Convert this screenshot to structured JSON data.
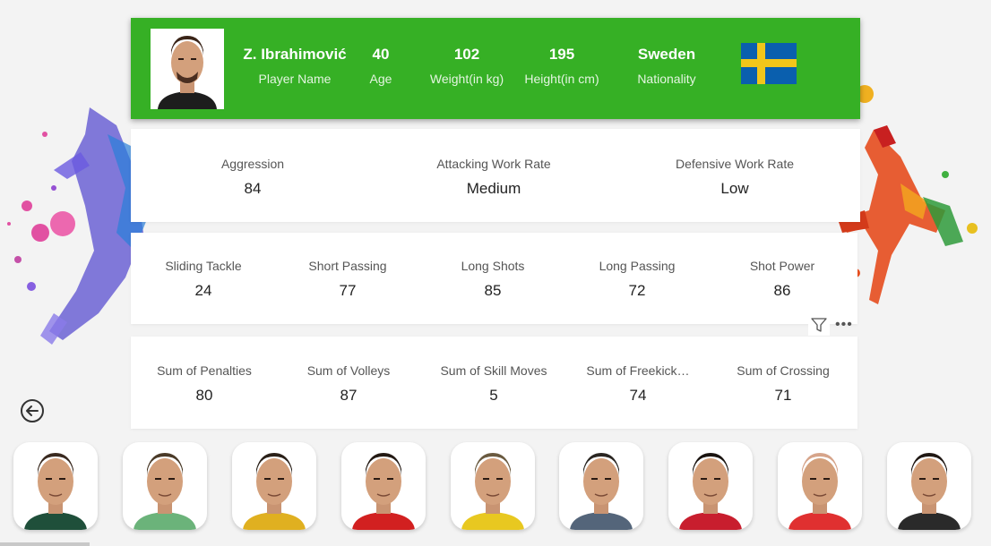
{
  "header": {
    "player_name": "Z. Ibrahimović",
    "player_name_label": "Player Name",
    "age": "40",
    "age_label": "Age",
    "weight": "102",
    "weight_label": "Weight(in kg)",
    "height": "195",
    "height_label": "Height(in cm)",
    "nationality": "Sweden",
    "nationality_label": "Nationality",
    "flag_icon": "sweden-flag-icon",
    "background_color": "#36b025"
  },
  "work_stats": [
    {
      "label": "Aggression",
      "value": "84"
    },
    {
      "label": "Attacking Work Rate",
      "value": "Medium"
    },
    {
      "label": "Defensive Work Rate",
      "value": "Low"
    }
  ],
  "skill_stats": [
    {
      "label": "Sliding Tackle",
      "value": "24"
    },
    {
      "label": "Short Passing",
      "value": "77"
    },
    {
      "label": "Long Shots",
      "value": "85"
    },
    {
      "label": "Long Passing",
      "value": "72"
    },
    {
      "label": "Shot Power",
      "value": "86"
    }
  ],
  "sum_stats": [
    {
      "label": "Sum of Penalties",
      "value": "80"
    },
    {
      "label": "Sum of Volleys",
      "value": "87"
    },
    {
      "label": "Sum of Skill Moves",
      "value": "5"
    },
    {
      "label": "Sum of Freekick…",
      "value": "74"
    },
    {
      "label": "Sum of Crossing",
      "value": "71"
    }
  ],
  "icons": {
    "filter": "filter-icon",
    "more": "more-options-icon",
    "back": "back-arrow-icon"
  },
  "carousel": {
    "players": [
      {
        "jersey": "#1f4f3a",
        "hair": "#3a2a20"
      },
      {
        "jersey": "#6bb37a",
        "hair": "#4a3a28"
      },
      {
        "jersey": "#e0b020",
        "hair": "#2a2018"
      },
      {
        "jersey": "#d22020",
        "hair": "#241a14"
      },
      {
        "jersey": "#e8c820",
        "hair": "#6a5a40"
      },
      {
        "jersey": "#54657a",
        "hair": "#2a2622"
      },
      {
        "jersey": "#c81e2e",
        "hair": "#1a1410"
      },
      {
        "jersey": "#e03030",
        "hair": "#d6a48a"
      },
      {
        "jersey": "#2a2a2a",
        "hair": "#201814"
      }
    ]
  }
}
